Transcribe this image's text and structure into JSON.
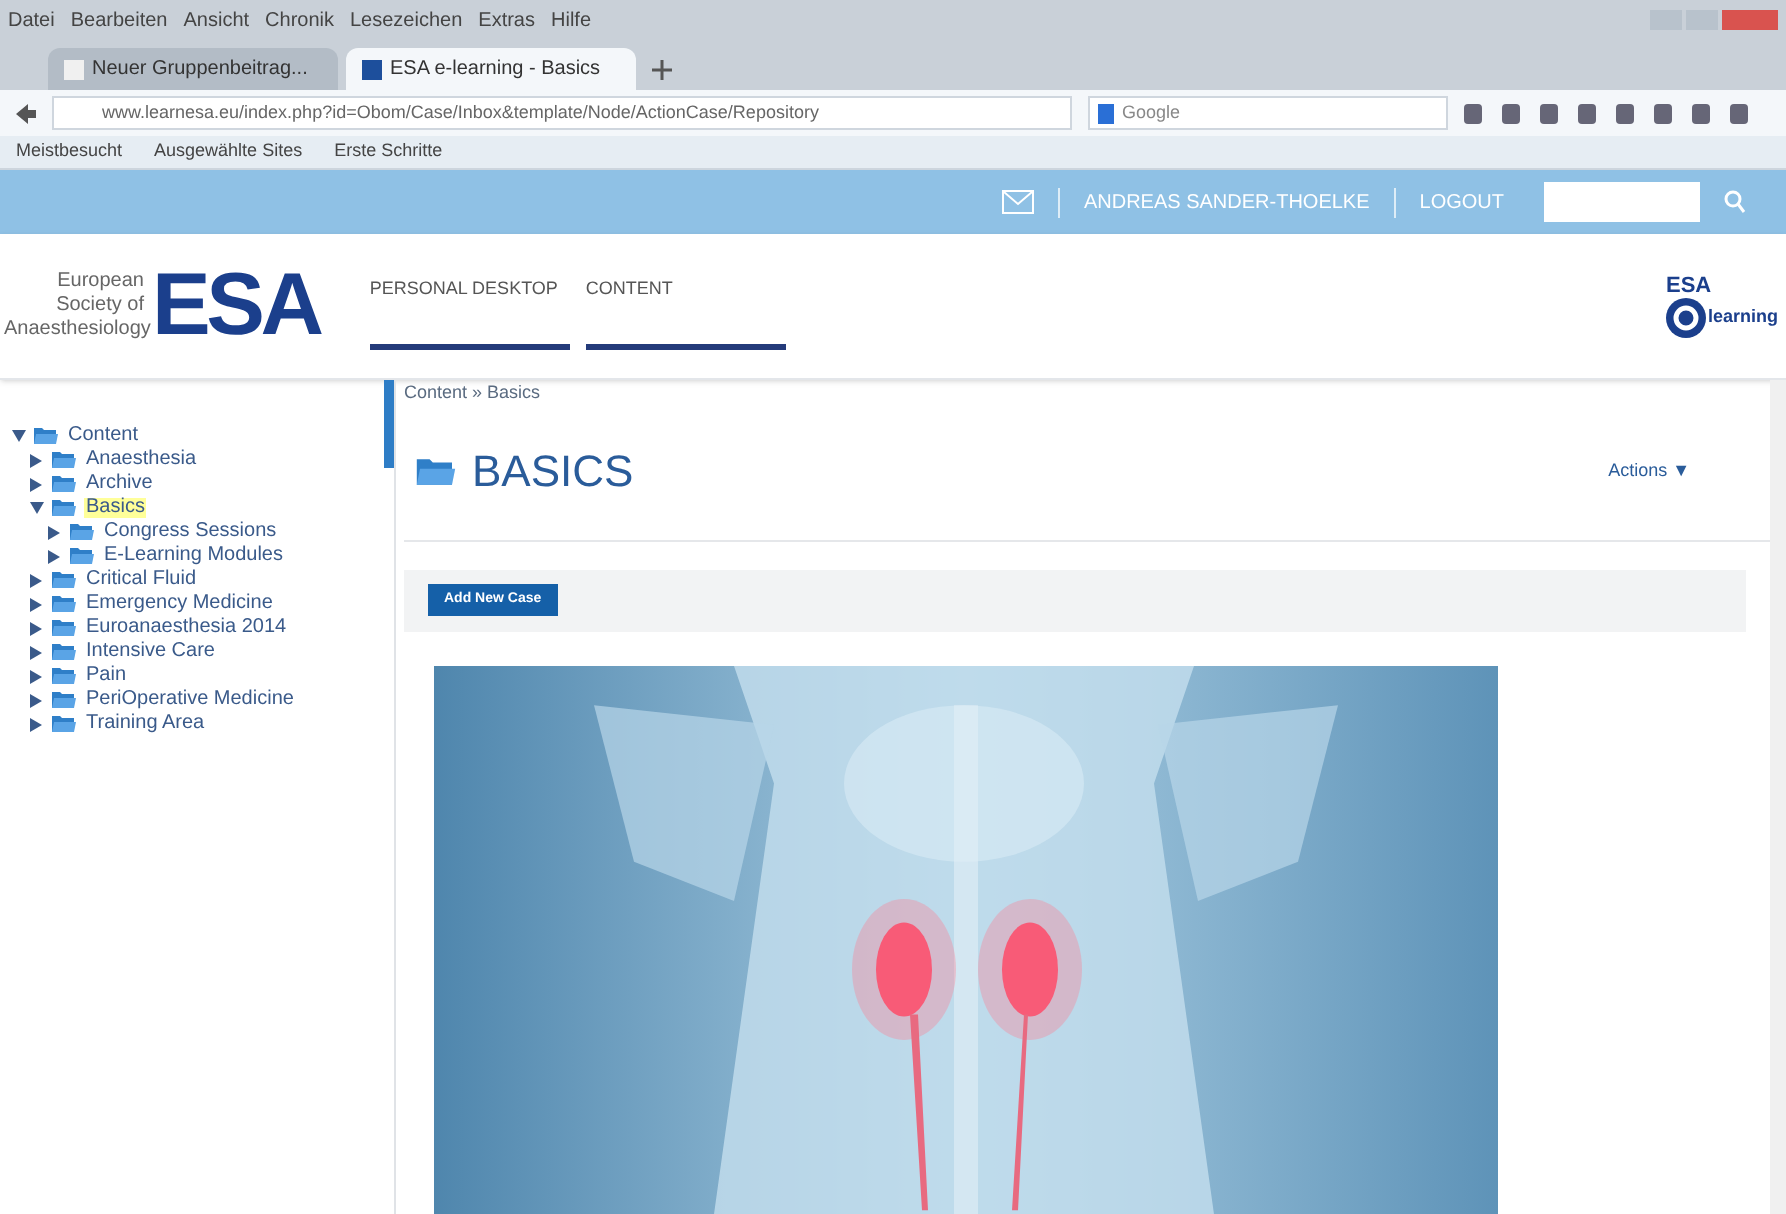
{
  "browser": {
    "menu": [
      "Datei",
      "Bearbeiten",
      "Ansicht",
      "Chronik",
      "Lesezeichen",
      "Extras",
      "Hilfe"
    ],
    "tabs": [
      {
        "label": "Neuer Gruppenbeitrag...",
        "selected": false
      },
      {
        "label": "ESA e-learning - Basics",
        "selected": true
      }
    ],
    "url": "www.learnesa.eu/index.php?id=Obom/Case/Inbox&template/Node/ActionCase/Repository",
    "search_placeholder": "Google",
    "bookmarks": [
      "Meistbesucht",
      "Ausgewählte Sites",
      "Erste Schritte"
    ]
  },
  "topbar": {
    "user": "ANDREAS SANDER-THOELKE",
    "logout": "LOGOUT"
  },
  "header": {
    "society": "European Society of Anaesthesiology",
    "logo": "ESA",
    "elogo_top": "ESA",
    "elogo_text": "learning",
    "nav": [
      {
        "label": "PERSONAL DESKTOP"
      },
      {
        "label": "CONTENT"
      }
    ]
  },
  "tree": {
    "label": "Content",
    "expanded": true,
    "selected": false,
    "children": [
      {
        "label": "Anaesthesia",
        "expanded": false,
        "selected": false
      },
      {
        "label": "Archive",
        "expanded": false,
        "selected": false
      },
      {
        "label": "Basics",
        "expanded": true,
        "selected": true,
        "children": [
          {
            "label": "Congress Sessions",
            "expanded": false,
            "selected": false
          },
          {
            "label": "E-Learning Modules",
            "expanded": false,
            "selected": false
          }
        ]
      },
      {
        "label": "Critical Fluid",
        "expanded": false,
        "selected": false
      },
      {
        "label": "Emergency Medicine",
        "expanded": false,
        "selected": false
      },
      {
        "label": "Euroanaesthesia 2014",
        "expanded": false,
        "selected": false
      },
      {
        "label": "Intensive Care",
        "expanded": false,
        "selected": false
      },
      {
        "label": "Pain",
        "expanded": false,
        "selected": false
      },
      {
        "label": "PeriOperative Medicine",
        "expanded": false,
        "selected": false
      },
      {
        "label": "Training Area",
        "expanded": false,
        "selected": false
      }
    ]
  },
  "content": {
    "breadcrumb": "Content » Basics",
    "title": "BASICS",
    "actions": "Actions ▼",
    "add_button": "Add New Case"
  }
}
